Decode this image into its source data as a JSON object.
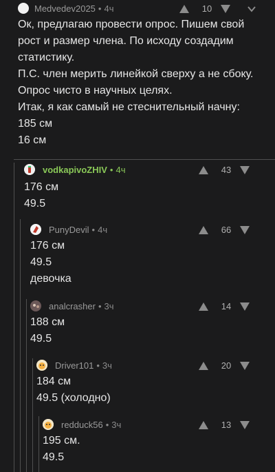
{
  "comments": [
    {
      "username": "Medvedev2025",
      "time": "4ч",
      "score": "10",
      "lines": [
        "Ок, предлагаю провести опрос. Пишем свой",
        "рост и размер члена. По исходу создадим",
        "статистику.",
        "П.С. член мерить линейкой сверху а не сбоку.",
        "Опрос чисто в научных целях.",
        "Итак, я как самый не стеснительный начну:",
        "185 см",
        "16 см"
      ]
    },
    {
      "username": "vodkapivoZHIV",
      "time": "4ч",
      "score": "43",
      "lines": [
        "176 см",
        "49.5"
      ]
    },
    {
      "username": "PunyDevil",
      "time": "4ч",
      "score": "66",
      "lines": [
        "176 см",
        "49.5",
        "девочка"
      ]
    },
    {
      "username": "analcrasher",
      "time": "3ч",
      "score": "14",
      "lines": [
        "188 см",
        "49.5"
      ]
    },
    {
      "username": "Driver101",
      "time": "3ч",
      "score": "20",
      "lines": [
        "184 см",
        "49.5 (холодно)"
      ]
    },
    {
      "username": "redduck56",
      "time": "3ч",
      "score": "13",
      "lines": [
        "195 см.",
        "49.5"
      ]
    }
  ],
  "icons": {
    "upvote": "arrow-up-icon",
    "downvote": "arrow-down-icon"
  },
  "colors": {
    "background": "#1b1b1c",
    "text": "#e6e6e6",
    "meta": "#8b8b8b",
    "highlight_user": "#8ac858",
    "thread_line": "#505050"
  }
}
